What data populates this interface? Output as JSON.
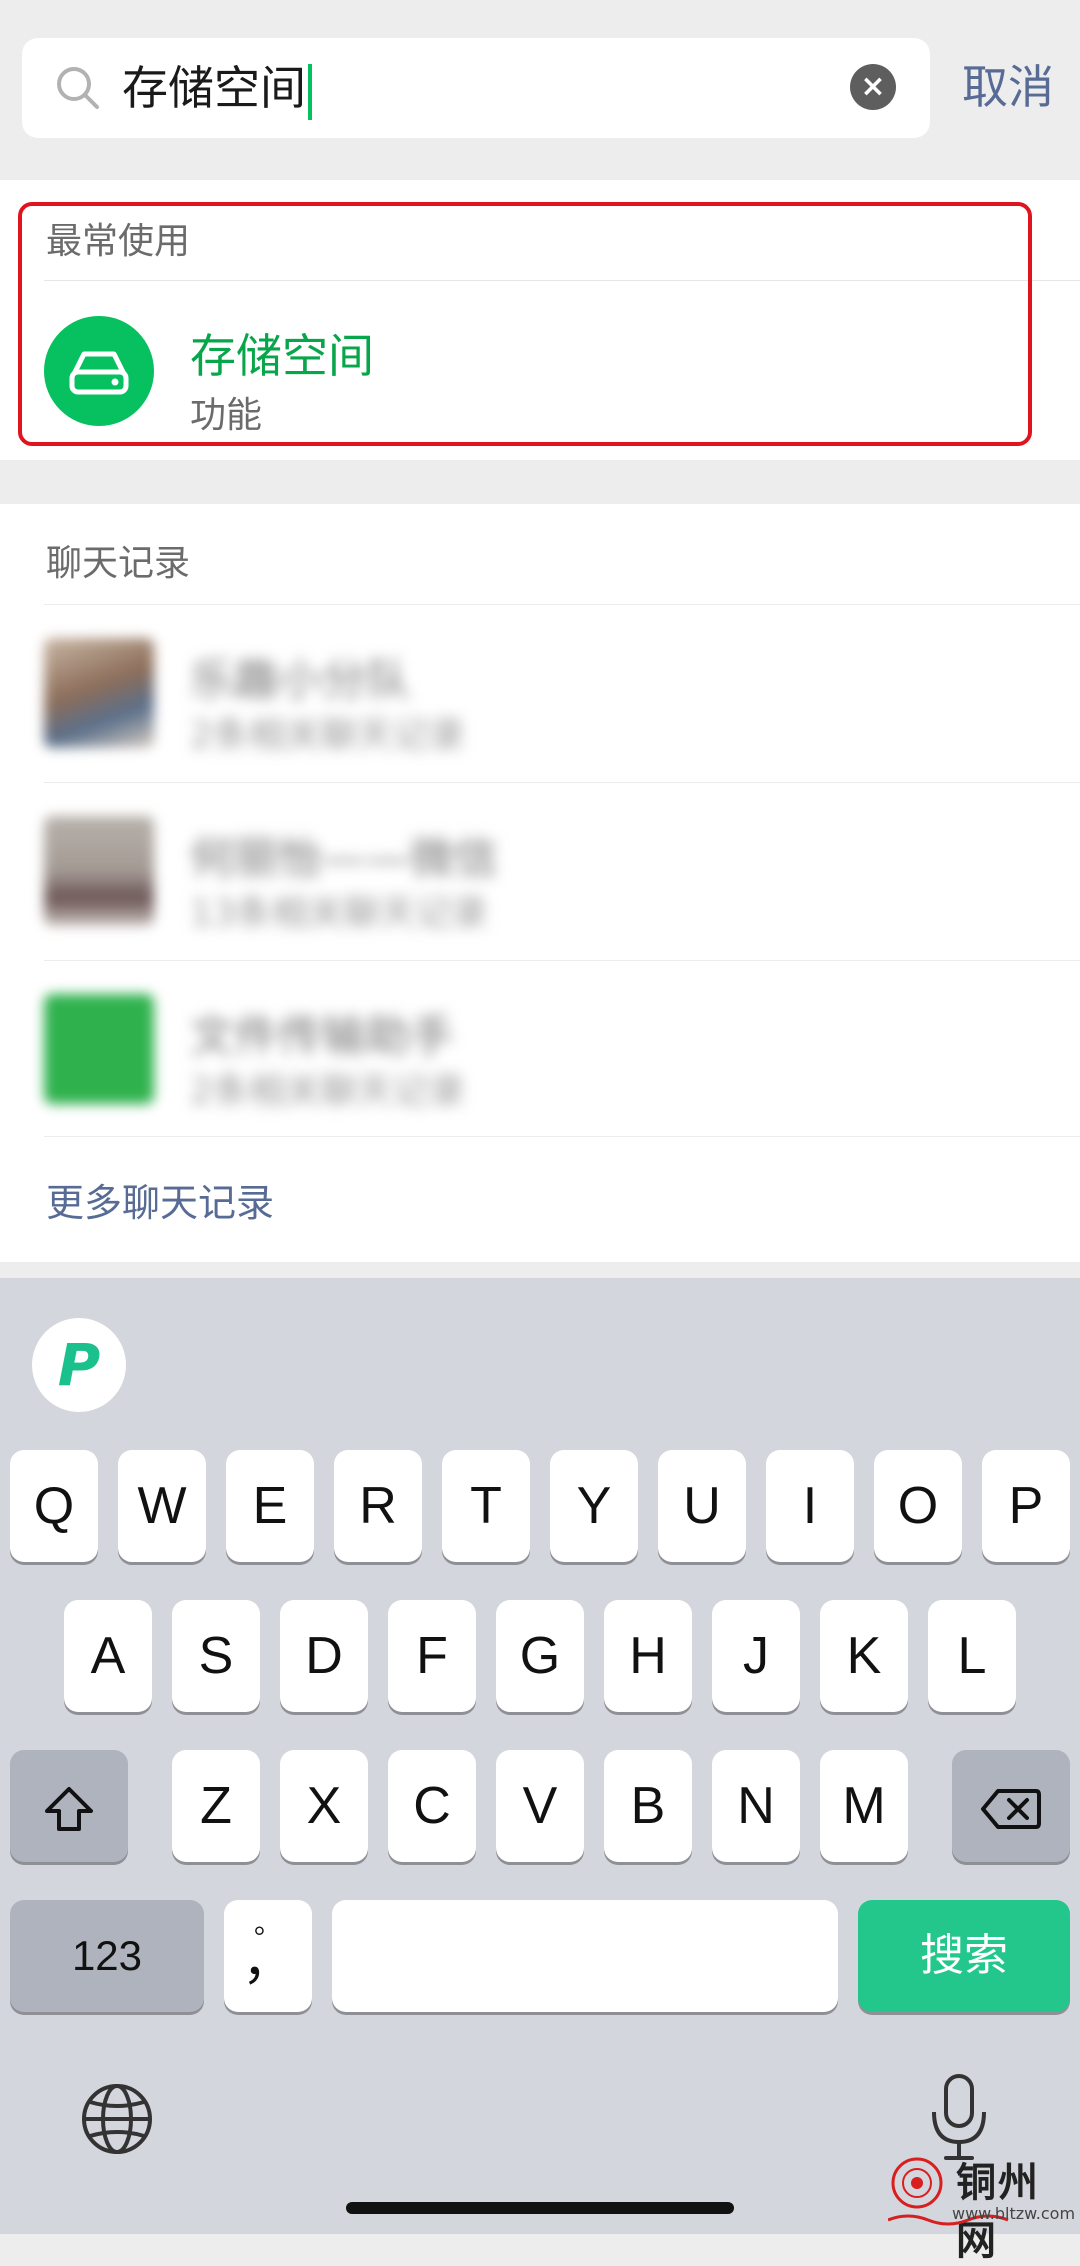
{
  "search": {
    "query": "存储空间",
    "cancel_label": "取消"
  },
  "frequent": {
    "header": "最常使用",
    "item": {
      "title": "存储空间",
      "subtitle": "功能"
    }
  },
  "chats": {
    "header": "聊天记录",
    "items": [
      {
        "title": "乐趣小分队",
        "subtitle": "2条相关聊天记录",
        "avatar_color": "#a08a7a"
      },
      {
        "title": "何丽怡——微信",
        "subtitle": "13条相关聊天记录",
        "avatar_color": "#9a8f8c"
      },
      {
        "title": "文件传输助手",
        "subtitle": "2条相关聊天记录",
        "avatar_color": "#2fb24d"
      }
    ],
    "more_label": "更多聊天记录"
  },
  "keyboard": {
    "logo_label": "P",
    "row1": [
      "Q",
      "W",
      "E",
      "R",
      "T",
      "Y",
      "U",
      "I",
      "O",
      "P"
    ],
    "row2": [
      "A",
      "S",
      "D",
      "F",
      "G",
      "H",
      "J",
      "K",
      "L"
    ],
    "row3": [
      "Z",
      "X",
      "C",
      "V",
      "B",
      "N",
      "M"
    ],
    "numbers_label": "123",
    "punct_top": "。",
    "punct_bottom": "，",
    "search_label": "搜索"
  },
  "watermark": {
    "text": "铜州网",
    "url": "www.bltzw.com"
  },
  "colors": {
    "accent_green": "#07c160",
    "link_blue": "#576b95",
    "highlight_red": "#e0141e",
    "keyboard_search": "#24c78b"
  }
}
